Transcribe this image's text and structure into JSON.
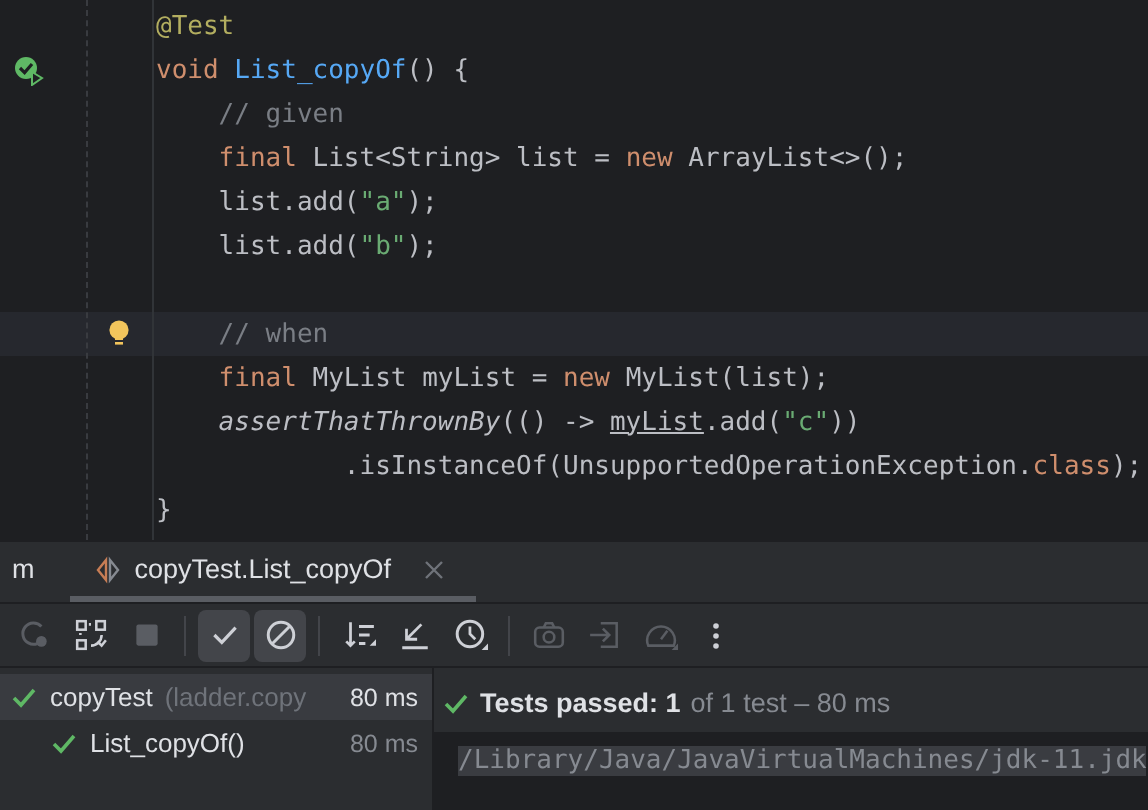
{
  "editor": {
    "lines": [
      {
        "kind": "code",
        "tokens": [
          {
            "kind": "annotation",
            "text": "@Test"
          }
        ]
      },
      {
        "kind": "code",
        "gutter": {
          "kind": "run-passed"
        },
        "tokens": [
          {
            "kind": "keyword",
            "text": "void "
          },
          {
            "kind": "declaration",
            "text": "List_copyOf"
          },
          {
            "kind": "plain",
            "text": "() {"
          }
        ]
      },
      {
        "kind": "code",
        "tokens": [
          {
            "kind": "comment",
            "text": "    // given"
          }
        ]
      },
      {
        "kind": "code",
        "tokens": [
          {
            "kind": "keyword",
            "text": "    final "
          },
          {
            "kind": "plain",
            "text": "List<String> list = "
          },
          {
            "kind": "keyword",
            "text": "new "
          },
          {
            "kind": "plain",
            "text": "ArrayList<>();"
          }
        ]
      },
      {
        "kind": "code",
        "tokens": [
          {
            "kind": "plain",
            "text": "    list.add("
          },
          {
            "kind": "string",
            "text": "\"a\""
          },
          {
            "kind": "plain",
            "text": ");"
          }
        ]
      },
      {
        "kind": "code",
        "tokens": [
          {
            "kind": "plain",
            "text": "    list.add("
          },
          {
            "kind": "string",
            "text": "\"b\""
          },
          {
            "kind": "plain",
            "text": ");"
          }
        ]
      },
      {
        "kind": "blank"
      },
      {
        "kind": "code",
        "gutter": {
          "kind": "bulb"
        },
        "current": true,
        "tokens": [
          {
            "kind": "comment",
            "text": "    // when"
          }
        ]
      },
      {
        "kind": "code",
        "tokens": [
          {
            "kind": "keyword",
            "text": "    final "
          },
          {
            "kind": "plain",
            "text": "MyList myList = "
          },
          {
            "kind": "keyword",
            "text": "new "
          },
          {
            "kind": "plain",
            "text": "MyList(list);"
          }
        ]
      },
      {
        "kind": "code",
        "tokens": [
          {
            "kind": "static-call",
            "text": "    assertThatThrownBy"
          },
          {
            "kind": "plain",
            "text": "(() -> "
          },
          {
            "kind": "reassigned",
            "text": "myList"
          },
          {
            "kind": "plain",
            "text": ".add("
          },
          {
            "kind": "string",
            "text": "\"c\""
          },
          {
            "kind": "plain",
            "text": "))"
          }
        ]
      },
      {
        "kind": "code",
        "tokens": [
          {
            "kind": "plain",
            "text": "            .isInstanceOf(UnsupportedOperationException."
          },
          {
            "kind": "keyword",
            "text": "class"
          },
          {
            "kind": "plain",
            "text": ");"
          }
        ]
      },
      {
        "kind": "code",
        "tokens": [
          {
            "kind": "plain",
            "text": "}"
          }
        ]
      }
    ]
  },
  "run_panel": {
    "tabs": [
      {
        "label": "m",
        "selected": false,
        "closable": false
      },
      {
        "label": "copyTest.List_copyOf",
        "selected": true,
        "closable": true
      }
    ],
    "toolbar": [
      {
        "kind": "rerun",
        "disabled": true,
        "selected": false
      },
      {
        "kind": "rerun-failed",
        "disabled": false,
        "selected": false
      },
      {
        "kind": "stop",
        "disabled": true,
        "selected": false
      },
      {
        "kind": "separator"
      },
      {
        "kind": "show-passed",
        "disabled": false,
        "selected": true
      },
      {
        "kind": "show-ignored",
        "disabled": false,
        "selected": true
      },
      {
        "kind": "separator"
      },
      {
        "kind": "sort",
        "disabled": false,
        "selected": false
      },
      {
        "kind": "collapse",
        "disabled": false,
        "selected": false
      },
      {
        "kind": "history",
        "disabled": false,
        "selected": false
      },
      {
        "kind": "separator"
      },
      {
        "kind": "camera",
        "disabled": true,
        "selected": false
      },
      {
        "kind": "import",
        "disabled": true,
        "selected": false
      },
      {
        "kind": "gauge",
        "disabled": true,
        "selected": false
      },
      {
        "kind": "more",
        "disabled": false,
        "selected": false
      }
    ],
    "tree": [
      {
        "label": "copyTest",
        "detail": "(ladder.copy",
        "time": "80 ms",
        "passed": true,
        "selected": true,
        "children": [
          {
            "label": "List_copyOf()",
            "time": "80 ms",
            "passed": true,
            "selected": false
          }
        ]
      }
    ],
    "summary": {
      "passed": true,
      "headline": "Tests passed: 1",
      "detail": "of 1 test – 80 ms"
    },
    "console": [
      {
        "text": "/Library/Java/JavaVirtualMachines/jdk-11.jdk",
        "highlighted": true
      }
    ]
  }
}
